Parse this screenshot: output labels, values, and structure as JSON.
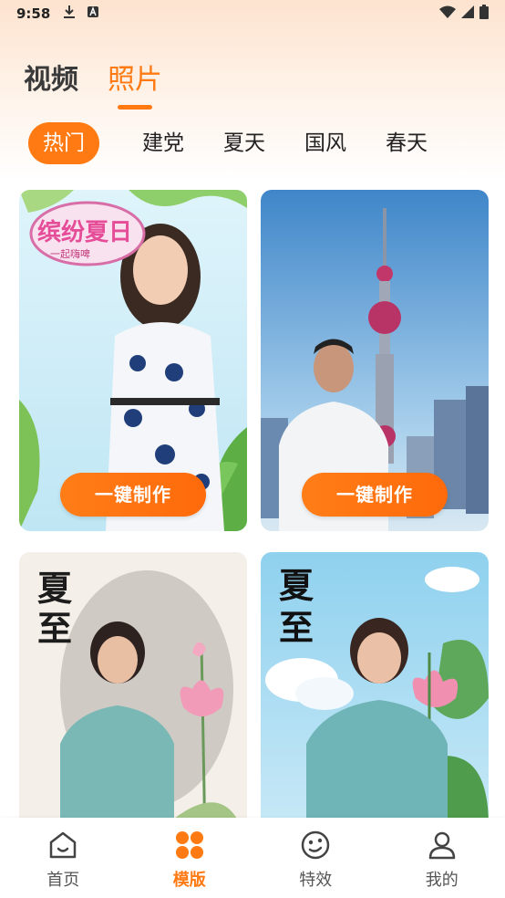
{
  "status_bar": {
    "time": "9:58",
    "icons": [
      "download-icon",
      "a-badge-icon",
      "wifi-icon",
      "signal-icon",
      "battery-icon"
    ]
  },
  "top_tabs": [
    {
      "label": "视频",
      "active": false
    },
    {
      "label": "照片",
      "active": true
    }
  ],
  "categories": [
    {
      "label": "热门",
      "active": true
    },
    {
      "label": "建党",
      "active": false
    },
    {
      "label": "夏天",
      "active": false
    },
    {
      "label": "国风",
      "active": false
    },
    {
      "label": "春天",
      "active": false
    }
  ],
  "cards": [
    {
      "button_label": "一键制作",
      "overlay_title": "缤纷夏日",
      "overlay_subtitle": "一起嗨啤"
    },
    {
      "button_label": "一键制作"
    },
    {
      "calligraphy": "夏至"
    },
    {
      "calligraphy": "夏至"
    }
  ],
  "bottom_nav": [
    {
      "label": "首页",
      "icon": "home-face-icon",
      "active": false
    },
    {
      "label": "模版",
      "icon": "grid-dots-icon",
      "active": true
    },
    {
      "label": "特效",
      "icon": "effect-face-icon",
      "active": false
    },
    {
      "label": "我的",
      "icon": "user-icon",
      "active": false
    }
  ],
  "colors": {
    "accent": "#ff7a12",
    "text": "#222222"
  }
}
